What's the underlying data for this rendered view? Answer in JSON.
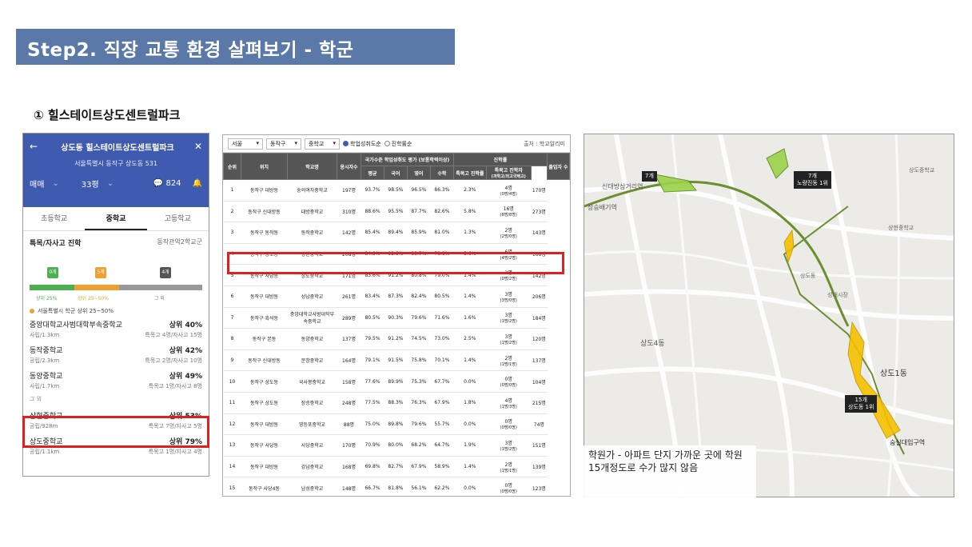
{
  "banner": {
    "title": "Step2. 직장 교통 환경 살펴보기 - 학군"
  },
  "subtitle": "① 힐스테이트상도센트럴파크",
  "phone": {
    "title": "상도동 힐스테이트상도센트럴파크",
    "address": "서울특별시 동작구 상도동 531",
    "deal": "매매",
    "size": "33평",
    "comments": "824",
    "tabs": [
      "초등학교",
      "중학교",
      "고등학교"
    ],
    "active_tab": "중학교",
    "section_title": "특목/자사고 진학",
    "district": "동작관악2학교군",
    "flags": [
      "0개",
      "5개",
      "4개"
    ],
    "bar_labels": [
      "상위 25%",
      "상위 25~50%",
      "그 외"
    ],
    "note": "서울특별시 학군 상위 25~50%",
    "schools": [
      {
        "name": "중앙대학교사범대학부속중학교",
        "rank": "상위 40%",
        "meta": "사립/1.3km",
        "detail": "특목고 4명/자사고 15명"
      },
      {
        "name": "동작중학교",
        "rank": "상위 42%",
        "meta": "공립/2.3km",
        "detail": "특목고 2명/자사고 10명"
      },
      {
        "name": "동양중학교",
        "rank": "상위 49%",
        "meta": "사립/1.7km",
        "detail": "특목고 1명/자사고 8명"
      },
      {
        "name": "상현중학교",
        "rank": "상위 53%",
        "meta": "공립/928m",
        "detail": "특목고 7명/자사고 5명"
      },
      {
        "name": "상도중학교",
        "rank": "상위 79%",
        "meta": "공립/1.1km",
        "detail": "특목고 1명/자사고 4명"
      }
    ],
    "divider": "그 외"
  },
  "table": {
    "filters": {
      "city": "서울",
      "district": "동작구",
      "level": "중학교",
      "radio1": "학업성취도순",
      "radio2": "진학률순",
      "source": "출처 : 학교알리미"
    },
    "headers": {
      "rank": "순위",
      "loc": "위치",
      "school": "학교명",
      "students": "응시자수",
      "group1": "국가수준 학업성취도 평가 (보통학력이상)",
      "avg": "평균",
      "kor": "국어",
      "eng": "영어",
      "math": "수학",
      "group2": "진학률",
      "special": "특목고 진학률",
      "special2": "특목고 진학자",
      "special2_sub": "(과학고/외고국제고)",
      "grad": "졸업자 수"
    },
    "rows": [
      [
        "1",
        "동작구 대방동",
        "숭의여자중학교",
        "197명",
        "93.7%",
        "98.5%",
        "96.5%",
        "86.3%",
        "2.3%",
        "4명",
        "(0명/4명)",
        "170명"
      ],
      [
        "2",
        "동작구 신대방동",
        "대방중학교",
        "310명",
        "88.6%",
        "95.5%",
        "87.7%",
        "82.6%",
        "5.8%",
        "16명",
        "(8명/8명)",
        "273명"
      ],
      [
        "3",
        "동작구 동작동",
        "동작중학교",
        "142명",
        "85.4%",
        "89.4%",
        "85.9%",
        "81.0%",
        "1.3%",
        "2명",
        "(2명/0명)",
        "143명"
      ],
      [
        "4",
        "동작구 상도동",
        "상현중학교",
        "208명",
        "84.9%",
        "92.3%",
        "83.7%",
        "78.9%",
        "3.6%",
        "6명",
        "(4명/2명)",
        "166명"
      ],
      [
        "5",
        "동작구 사당동",
        "상도중학교",
        "171명",
        "83.6%",
        "91.2%",
        "80.8%",
        "79.0%",
        "1.4%",
        "2명",
        "(0명/2명)",
        "142명"
      ],
      [
        "6",
        "동작구 대방동",
        "성남중학교",
        "261명",
        "83.4%",
        "87.3%",
        "82.4%",
        "80.5%",
        "1.4%",
        "3명",
        "(3명/0명)",
        "206명"
      ],
      [
        "7",
        "동작구 흑석동",
        "중앙대학교사범대학부속중학교",
        "289명",
        "80.5%",
        "90.3%",
        "79.6%",
        "71.6%",
        "1.6%",
        "3명",
        "(1명/2명)",
        "184명"
      ],
      [
        "8",
        "동작구 본동",
        "동양중학교",
        "137명",
        "79.5%",
        "91.2%",
        "74.5%",
        "73.0%",
        "2.5%",
        "3명",
        "(1명/2명)",
        "120명"
      ],
      [
        "9",
        "동작구 신대방동",
        "문창중학교",
        "164명",
        "79.1%",
        "91.5%",
        "75.8%",
        "70.1%",
        "1.4%",
        "2명",
        "(1명/1명)",
        "137명"
      ],
      [
        "10",
        "동작구 상도동",
        "국사봉중학교",
        "158명",
        "77.6%",
        "89.9%",
        "75.3%",
        "67.7%",
        "0.0%",
        "0명",
        "(0명/0명)",
        "104명"
      ],
      [
        "11",
        "동작구 상도동",
        "장승중학교",
        "248명",
        "77.5%",
        "88.3%",
        "76.3%",
        "67.9%",
        "1.8%",
        "4명",
        "(1명/3명)",
        "215명"
      ],
      [
        "12",
        "동작구 대방동",
        "영등포중학교",
        "88명",
        "75.0%",
        "89.8%",
        "79.6%",
        "55.7%",
        "0.0%",
        "0명",
        "(0명/0명)",
        "74명"
      ],
      [
        "13",
        "동작구 사당동",
        "사당중학교",
        "170명",
        "70.9%",
        "80.0%",
        "68.2%",
        "64.7%",
        "1.9%",
        "3명",
        "(1명/2명)",
        "151명"
      ],
      [
        "14",
        "동작구 대방동",
        "강남중학교",
        "168명",
        "69.8%",
        "82.7%",
        "67.9%",
        "58.9%",
        "1.4%",
        "2명",
        "(1명/1명)",
        "139명"
      ],
      [
        "15",
        "동작구 사당4동",
        "남성중학교",
        "148명",
        "66.7%",
        "81.8%",
        "56.1%",
        "62.2%",
        "0.0%",
        "0명",
        "(0명/0명)",
        "123명"
      ]
    ]
  },
  "map": {
    "caption": "학원가 - 아파트 단지 가까운 곳에 학원 15개정도로 수가 많지 않음",
    "badges": [
      {
        "count": "7개",
        "sub": ""
      },
      {
        "count": "7개",
        "sub": "노량진동 1위"
      },
      {
        "count": "15개",
        "sub": "상도동 1위"
      }
    ],
    "places": [
      "상도1동",
      "상도4동",
      "신대방삼거리역",
      "장승배기역",
      "숭실대입구역",
      "상도중학교",
      "상현중학교",
      "상도동",
      "성대시장"
    ],
    "accent": "#9bd24a",
    "highlight": "#f5c000"
  }
}
